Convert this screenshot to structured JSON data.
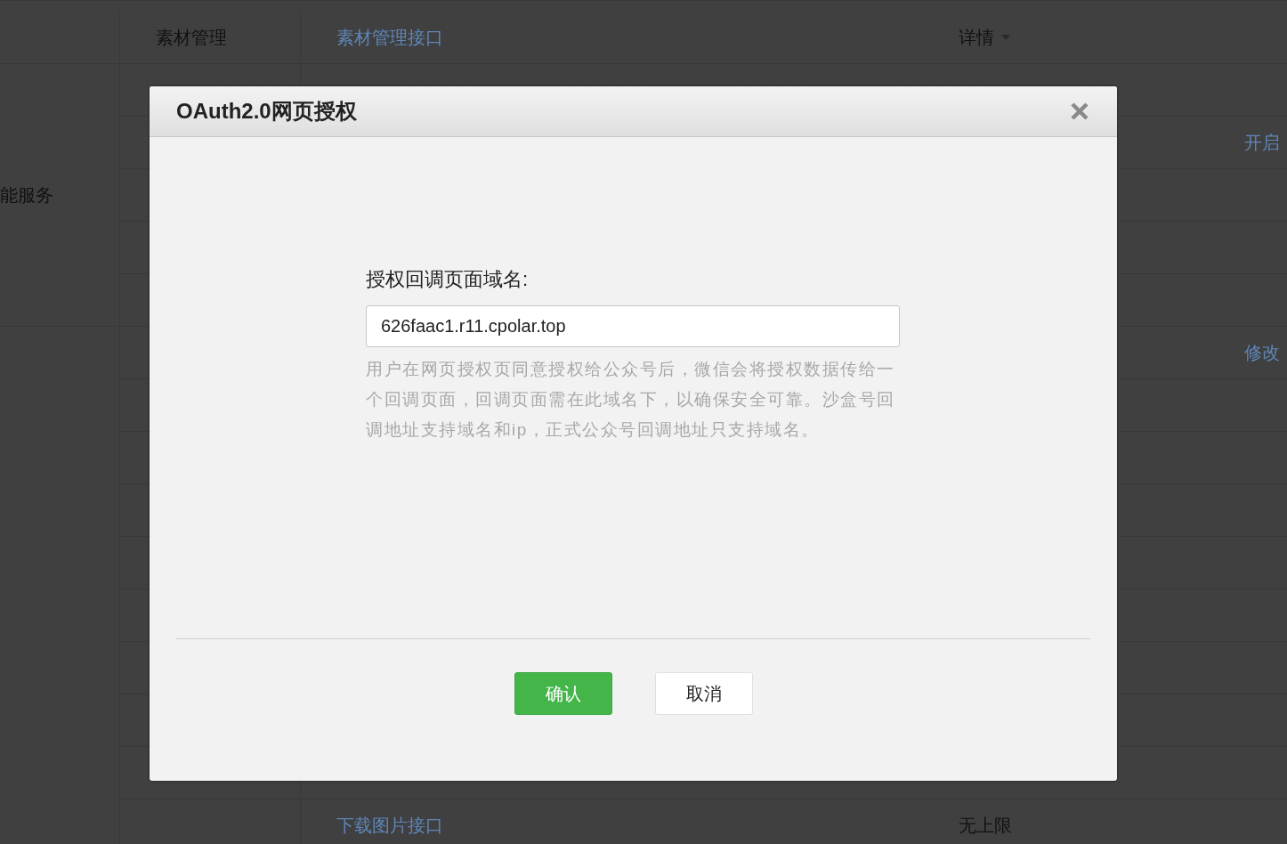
{
  "background": {
    "groups": [
      {
        "rows": [
          {
            "section": "素材管理",
            "interface": "素材管理接口",
            "quota": "详情",
            "quota_menu": true
          }
        ]
      },
      {
        "label": "能服务",
        "rows": [
          {},
          {
            "action": "开启"
          },
          {},
          {},
          {}
        ]
      },
      {
        "rows": [
          {
            "action": "修改"
          },
          {},
          {},
          {},
          {},
          {},
          {},
          {},
          {},
          {
            "interface": "下载图片接口",
            "quota": "无上限"
          }
        ]
      }
    ]
  },
  "dialog": {
    "title": "OAuth2.0网页授权",
    "field_label": "授权回调页面域名:",
    "value": "626faac1.r11.cpolar.top",
    "help": "用户在网页授权页同意授权给公众号后，微信会将授权数据传给一个回调页面，回调页面需在此域名下，以确保安全可靠。沙盒号回调地址支持域名和ip，正式公众号回调地址只支持域名。",
    "buttons": [
      {
        "label": "确认",
        "kind": "primary"
      },
      {
        "label": "取消",
        "kind": "secondary"
      }
    ]
  }
}
